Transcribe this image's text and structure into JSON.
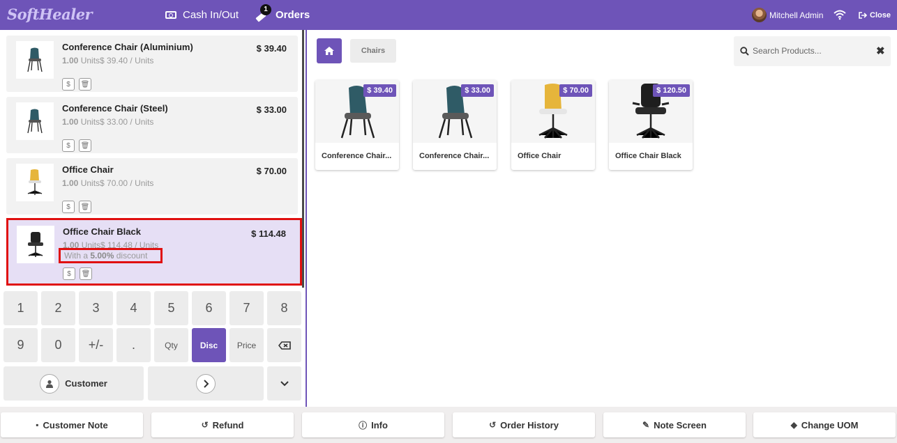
{
  "header": {
    "logo": "SoftHealer",
    "cash_label": "Cash In/Out",
    "orders_label": "Orders",
    "orders_badge": "1",
    "user_name": "Mitchell Admin",
    "close_label": "Close"
  },
  "orderlines": [
    {
      "name": "Conference Chair (Aluminium)",
      "price": "$ 39.40",
      "qty": "1.00",
      "unit_info": "Units$ 39.40 / Units"
    },
    {
      "name": "Conference Chair (Steel)",
      "price": "$ 33.00",
      "qty": "1.00",
      "unit_info": "Units$ 33.00 / Units"
    },
    {
      "name": "Office Chair",
      "price": "$ 70.00",
      "qty": "1.00",
      "unit_info": "Units$ 70.00 / Units"
    },
    {
      "name": "Office Chair Black",
      "price": "$ 114.48",
      "qty": "1.00",
      "unit_info": "Units$ 114.48 / Units",
      "discount_prefix": "With a",
      "discount_value": "5.00%",
      "discount_suffix": "discount",
      "selected": true
    }
  ],
  "line_buttons": {
    "price_icon": "$",
    "delete_icon": "trash-icon"
  },
  "numpad": {
    "row1": [
      "1",
      "2",
      "3",
      "4",
      "5",
      "6",
      "7",
      "8"
    ],
    "row2": [
      "9",
      "0",
      "+/-",
      ".",
      "Qty",
      "Disc",
      "Price"
    ],
    "active_mode": "Disc",
    "backspace_icon": "backspace-icon"
  },
  "customer_label": "Customer",
  "products_pane": {
    "breadcrumb": "Chairs",
    "search_placeholder": "Search Products...",
    "clear_label": "✖"
  },
  "products": [
    {
      "name": "Conference Chair (Aluminium)",
      "display_name": "Conference Chair...",
      "price": "$ 39.40"
    },
    {
      "name": "Conference Chair (Steel)",
      "display_name": "Conference Chair...",
      "price": "$ 33.00"
    },
    {
      "name": "Office Chair",
      "display_name": "Office Chair",
      "price": "$ 70.00"
    },
    {
      "name": "Office Chair Black",
      "display_name": "Office Chair Black",
      "price": "$ 120.50"
    }
  ],
  "bottom_buttons": [
    {
      "label": "Customer Note",
      "icon": "note-icon"
    },
    {
      "label": "Refund",
      "icon": "undo-icon"
    },
    {
      "label": "Info",
      "icon": "info-icon"
    },
    {
      "label": "Order History",
      "icon": "history-icon"
    },
    {
      "label": "Note Screen",
      "icon": "edit-icon"
    },
    {
      "label": "Change UOM",
      "icon": "tag-icon"
    }
  ],
  "colors": {
    "accent": "#6e54b8",
    "highlight": "#e01010",
    "selected_bg": "#e6dff5"
  }
}
